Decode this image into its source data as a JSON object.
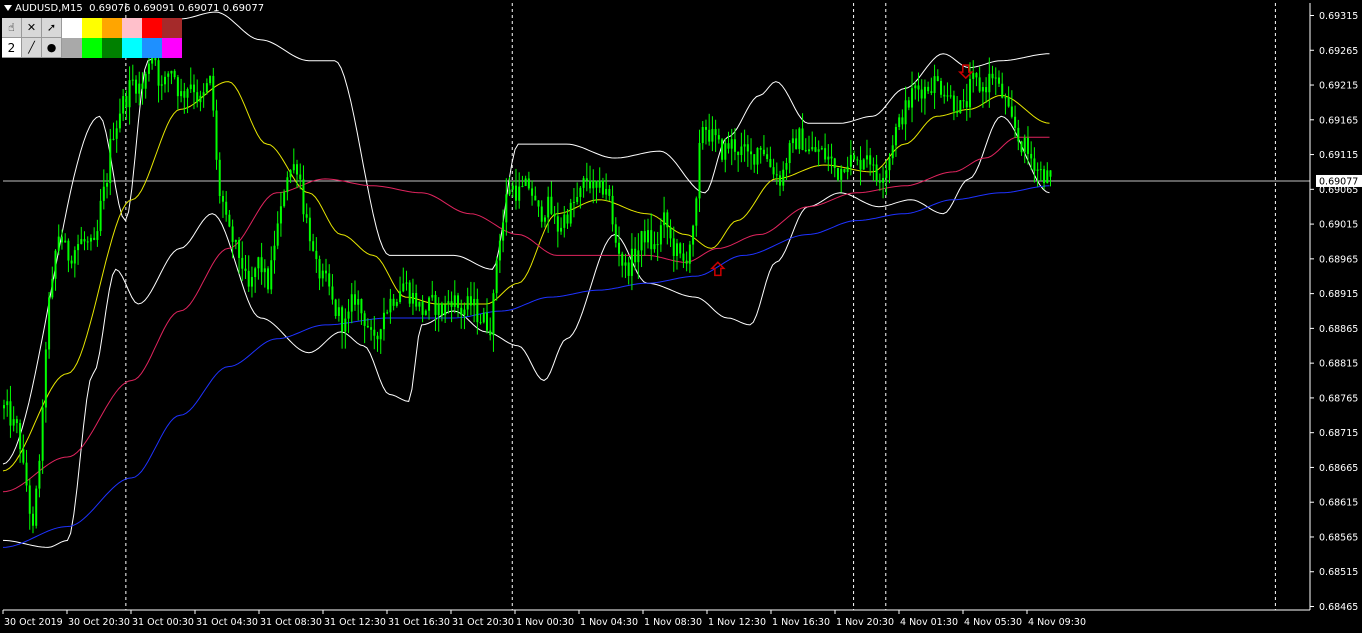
{
  "header": {
    "symbol": "AUDUSD,M15",
    "ohlc": "0.69076 0.69091 0.69071 0.69077"
  },
  "toolbar": {
    "row1_icons": [
      "hand-pointer-icon",
      "close-x-icon",
      "cursor-pointer-icon"
    ],
    "row2_label": "2",
    "row2_icons": [
      "line-tool-icon",
      "dot-tool-icon"
    ],
    "row1_colors": [
      "#ffffff",
      "#ffff00",
      "#ffa500",
      "#ffc0cb",
      "#ff0000",
      "#a52a2a"
    ],
    "row2_colors": [
      "#a9a9a9",
      "#00ff00",
      "#008000",
      "#00ffff",
      "#1e90ff",
      "#ff00ff"
    ]
  },
  "colors": {
    "candle": "#00ff00",
    "bands": "#ffffff",
    "ma_fast": "#e6e600",
    "ma_mid": "#e0245e",
    "ma_slow": "#1e32ff",
    "grid": "#ffffff",
    "arrow": "#cc0000",
    "price_line": "#c0c0c0"
  },
  "chart_data": {
    "type": "candlestick",
    "symbol": "AUDUSD",
    "timeframe": "M15",
    "current_price": "0.69077",
    "y_ticks": [
      "0.69315",
      "0.69265",
      "0.69215",
      "0.69165",
      "0.69115",
      "0.69065",
      "0.69015",
      "0.68965",
      "0.68915",
      "0.68865",
      "0.68815",
      "0.68765",
      "0.68715",
      "0.68665",
      "0.68615",
      "0.68565",
      "0.68515",
      "0.68465"
    ],
    "ylim": [
      0.68465,
      0.69315
    ],
    "x_ticks": [
      "30 Oct 2019",
      "30 Oct 20:30",
      "31 Oct 00:30",
      "31 Oct 04:30",
      "31 Oct 08:30",
      "31 Oct 12:30",
      "31 Oct 16:30",
      "31 Oct 20:30",
      "1 Nov 00:30",
      "1 Nov 04:30",
      "1 Nov 08:30",
      "1 Nov 12:30",
      "1 Nov 16:30",
      "1 Nov 20:30",
      "4 Nov 01:30",
      "4 Nov 05:30",
      "4 Nov 09:30"
    ],
    "close_path": [
      [
        0,
        0.6875
      ],
      [
        4,
        0.6872
      ],
      [
        7,
        0.6864
      ],
      [
        9,
        0.6857
      ],
      [
        11,
        0.6868
      ],
      [
        14,
        0.689
      ],
      [
        17,
        0.69
      ],
      [
        20,
        0.6897
      ],
      [
        24,
        0.6899
      ],
      [
        28,
        0.6898
      ],
      [
        31,
        0.6906
      ],
      [
        34,
        0.6915
      ],
      [
        37,
        0.6919
      ],
      [
        40,
        0.6922
      ],
      [
        43,
        0.6921
      ],
      [
        46,
        0.6927
      ],
      [
        49,
        0.6921
      ],
      [
        52,
        0.6924
      ],
      [
        55,
        0.692
      ],
      [
        58,
        0.6922
      ],
      [
        61,
        0.6919
      ],
      [
        64,
        0.6922
      ],
      [
        67,
        0.6906
      ],
      [
        70,
        0.69
      ],
      [
        73,
        0.6897
      ],
      [
        76,
        0.6892
      ],
      [
        79,
        0.6896
      ],
      [
        82,
        0.6893
      ],
      [
        85,
        0.6901
      ],
      [
        88,
        0.6909
      ],
      [
        91,
        0.691
      ],
      [
        94,
        0.6902
      ],
      [
        97,
        0.6895
      ],
      [
        100,
        0.6893
      ],
      [
        103,
        0.6889
      ],
      [
        106,
        0.6887
      ],
      [
        109,
        0.6891
      ],
      [
        112,
        0.6888
      ],
      [
        115,
        0.6884
      ],
      [
        118,
        0.6889
      ],
      [
        121,
        0.6891
      ],
      [
        124,
        0.6893
      ],
      [
        127,
        0.6891
      ],
      [
        130,
        0.6889
      ],
      [
        133,
        0.689
      ],
      [
        136,
        0.6889
      ],
      [
        139,
        0.6891
      ],
      [
        142,
        0.6889
      ],
      [
        145,
        0.689
      ],
      [
        148,
        0.6888
      ],
      [
        151,
        0.6887
      ],
      [
        154,
        0.69
      ],
      [
        157,
        0.6907
      ],
      [
        160,
        0.6906
      ],
      [
        163,
        0.6907
      ],
      [
        166,
        0.6903
      ],
      [
        169,
        0.6904
      ],
      [
        172,
        0.6901
      ],
      [
        175,
        0.6903
      ],
      [
        178,
        0.6905
      ],
      [
        181,
        0.6908
      ],
      [
        184,
        0.6906
      ],
      [
        187,
        0.6907
      ],
      [
        190,
        0.6899
      ],
      [
        193,
        0.6895
      ],
      [
        196,
        0.6897
      ],
      [
        199,
        0.69
      ],
      [
        202,
        0.6898
      ],
      [
        205,
        0.6902
      ],
      [
        208,
        0.6898
      ],
      [
        211,
        0.6896
      ],
      [
        214,
        0.69
      ],
      [
        217,
        0.6916
      ],
      [
        220,
        0.6914
      ],
      [
        223,
        0.6912
      ],
      [
        226,
        0.6913
      ],
      [
        229,
        0.6912
      ],
      [
        232,
        0.6911
      ],
      [
        235,
        0.6913
      ],
      [
        238,
        0.691
      ],
      [
        241,
        0.6908
      ],
      [
        244,
        0.6912
      ],
      [
        247,
        0.6914
      ],
      [
        250,
        0.6912
      ],
      [
        253,
        0.6912
      ],
      [
        256,
        0.6911
      ],
      [
        259,
        0.6909
      ],
      [
        262,
        0.6911
      ],
      [
        265,
        0.691
      ],
      [
        268,
        0.6912
      ],
      [
        271,
        0.6908
      ],
      [
        274,
        0.691
      ],
      [
        277,
        0.6915
      ],
      [
        280,
        0.6918
      ],
      [
        283,
        0.6921
      ],
      [
        286,
        0.6921
      ],
      [
        289,
        0.6922
      ],
      [
        292,
        0.6921
      ],
      [
        295,
        0.6919
      ],
      [
        298,
        0.6918
      ],
      [
        301,
        0.6922
      ],
      [
        304,
        0.6921
      ],
      [
        307,
        0.6923
      ],
      [
        310,
        0.692
      ],
      [
        313,
        0.6916
      ],
      [
        316,
        0.6913
      ],
      [
        319,
        0.6911
      ],
      [
        322,
        0.6909
      ],
      [
        325,
        0.6908
      ]
    ],
    "series": [
      {
        "name": "bands_upper",
        "points": [
          [
            0,
            0.6867
          ],
          [
            30,
            0.6917
          ],
          [
            38,
            0.6902
          ],
          [
            45,
            0.6925
          ],
          [
            55,
            0.6931
          ],
          [
            66,
            0.6932
          ],
          [
            80,
            0.6928
          ],
          [
            95,
            0.6925
          ],
          [
            103,
            0.6925
          ],
          [
            120,
            0.6897
          ],
          [
            140,
            0.6897
          ],
          [
            152,
            0.6895
          ],
          [
            160,
            0.6913
          ],
          [
            175,
            0.6913
          ],
          [
            190,
            0.6911
          ],
          [
            204,
            0.6912
          ],
          [
            218,
            0.6906
          ],
          [
            225,
            0.6914
          ],
          [
            235,
            0.692
          ],
          [
            240,
            0.6922
          ],
          [
            250,
            0.6916
          ],
          [
            260,
            0.6916
          ],
          [
            270,
            0.6917
          ],
          [
            280,
            0.6921
          ],
          [
            292,
            0.6926
          ],
          [
            300,
            0.6924
          ],
          [
            310,
            0.6925
          ],
          [
            325,
            0.6926
          ]
        ]
      },
      {
        "name": "bands_lower",
        "points": [
          [
            0,
            0.6856
          ],
          [
            14,
            0.6855
          ],
          [
            20,
            0.6856
          ],
          [
            28,
            0.688
          ],
          [
            35,
            0.6895
          ],
          [
            42,
            0.689
          ],
          [
            55,
            0.6898
          ],
          [
            65,
            0.6903
          ],
          [
            80,
            0.6888
          ],
          [
            95,
            0.6883
          ],
          [
            105,
            0.6886
          ],
          [
            112,
            0.6884
          ],
          [
            120,
            0.6877
          ],
          [
            126,
            0.6876
          ],
          [
            130,
            0.6887
          ],
          [
            140,
            0.6889
          ],
          [
            150,
            0.6886
          ],
          [
            160,
            0.6884
          ],
          [
            168,
            0.6879
          ],
          [
            175,
            0.6885
          ],
          [
            190,
            0.69
          ],
          [
            200,
            0.6893
          ],
          [
            215,
            0.6891
          ],
          [
            225,
            0.6888
          ],
          [
            232,
            0.6887
          ],
          [
            240,
            0.6896
          ],
          [
            250,
            0.6904
          ],
          [
            260,
            0.6906
          ],
          [
            272,
            0.6904
          ],
          [
            282,
            0.6905
          ],
          [
            292,
            0.6903
          ],
          [
            300,
            0.6908
          ],
          [
            310,
            0.6917
          ],
          [
            325,
            0.6906
          ]
        ]
      },
      {
        "name": "ma_fast",
        "points": [
          [
            0,
            0.6866
          ],
          [
            20,
            0.688
          ],
          [
            40,
            0.6905
          ],
          [
            55,
            0.6918
          ],
          [
            70,
            0.6922
          ],
          [
            82,
            0.6913
          ],
          [
            95,
            0.6906
          ],
          [
            105,
            0.69
          ],
          [
            115,
            0.6897
          ],
          [
            125,
            0.6891
          ],
          [
            135,
            0.689
          ],
          [
            150,
            0.689
          ],
          [
            160,
            0.6893
          ],
          [
            172,
            0.6903
          ],
          [
            185,
            0.6905
          ],
          [
            200,
            0.6903
          ],
          [
            212,
            0.69
          ],
          [
            220,
            0.6898
          ],
          [
            228,
            0.6902
          ],
          [
            240,
            0.6908
          ],
          [
            255,
            0.691
          ],
          [
            270,
            0.6909
          ],
          [
            280,
            0.6913
          ],
          [
            290,
            0.6917
          ],
          [
            300,
            0.6918
          ],
          [
            310,
            0.692
          ],
          [
            325,
            0.6916
          ]
        ]
      },
      {
        "name": "ma_mid",
        "points": [
          [
            0,
            0.6863
          ],
          [
            20,
            0.6868
          ],
          [
            40,
            0.6879
          ],
          [
            55,
            0.6889
          ],
          [
            70,
            0.6898
          ],
          [
            85,
            0.6906
          ],
          [
            100,
            0.6908
          ],
          [
            115,
            0.6907
          ],
          [
            130,
            0.6906
          ],
          [
            145,
            0.6903
          ],
          [
            160,
            0.69
          ],
          [
            172,
            0.6897
          ],
          [
            185,
            0.6897
          ],
          [
            200,
            0.6897
          ],
          [
            212,
            0.6896
          ],
          [
            222,
            0.6898
          ],
          [
            235,
            0.69
          ],
          [
            250,
            0.6904
          ],
          [
            265,
            0.6906
          ],
          [
            280,
            0.6907
          ],
          [
            295,
            0.6909
          ],
          [
            305,
            0.6911
          ],
          [
            315,
            0.6914
          ],
          [
            325,
            0.6914
          ]
        ]
      },
      {
        "name": "ma_slow",
        "points": [
          [
            0,
            0.6855
          ],
          [
            20,
            0.6858
          ],
          [
            40,
            0.6865
          ],
          [
            55,
            0.6874
          ],
          [
            70,
            0.6881
          ],
          [
            85,
            0.6885
          ],
          [
            100,
            0.6887
          ],
          [
            120,
            0.6888
          ],
          [
            140,
            0.6888
          ],
          [
            155,
            0.6889
          ],
          [
            170,
            0.6891
          ],
          [
            185,
            0.6892
          ],
          [
            200,
            0.6893
          ],
          [
            215,
            0.6894
          ],
          [
            230,
            0.6897
          ],
          [
            250,
            0.69
          ],
          [
            265,
            0.6902
          ],
          [
            280,
            0.6903
          ],
          [
            295,
            0.6905
          ],
          [
            310,
            0.6906
          ],
          [
            325,
            0.6907
          ]
        ]
      }
    ],
    "arrows": [
      {
        "direction": "up",
        "x": 222,
        "price": 0.6896
      },
      {
        "direction": "down",
        "x": 299,
        "price": 0.69225
      }
    ],
    "vertical_separators": [
      38,
      158,
      264,
      274,
      395
    ]
  }
}
